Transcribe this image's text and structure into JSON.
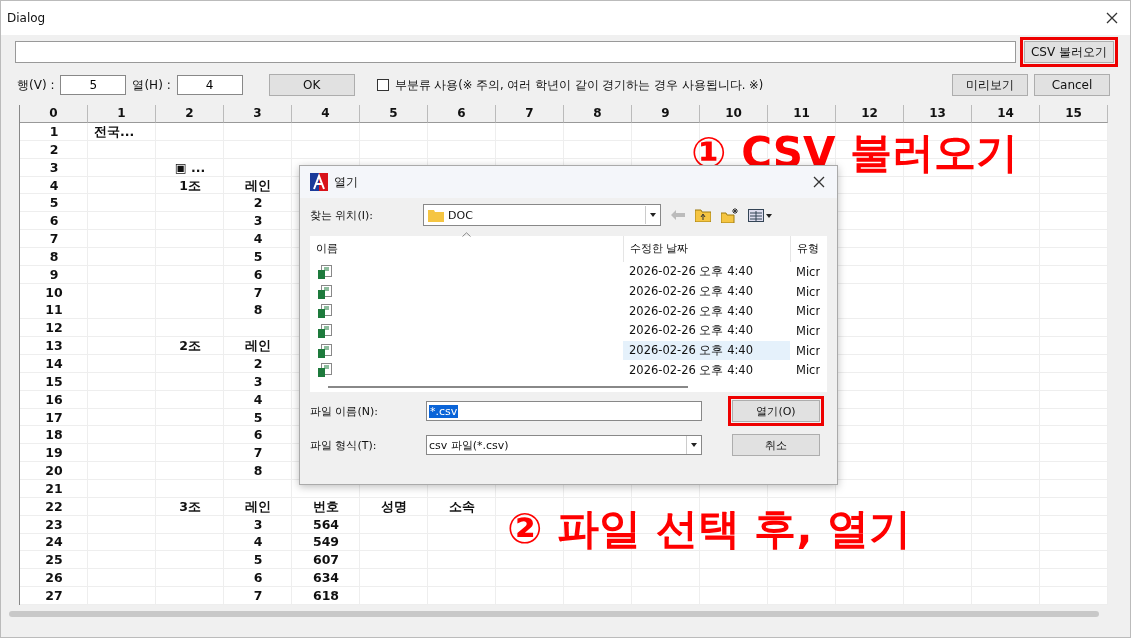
{
  "window": {
    "title": "Dialog"
  },
  "load_button": {
    "label": "CSV 불러오기"
  },
  "toolbar": {
    "rows_label": "행(V) :",
    "rows_value": "5",
    "cols_label": "열(H) :",
    "cols_value": "4",
    "ok": "OK",
    "subcategory": {
      "label": "부분류 사용(※ 주의, 여러 학년이 같이 경기하는 경우 사용됩니다. ※)",
      "checked": false
    },
    "preview": "미리보기",
    "cancel": "Cancel"
  },
  "grid": {
    "columns": [
      "0",
      "1",
      "2",
      "3",
      "4",
      "5",
      "6",
      "7",
      "8",
      "9",
      "10",
      "11",
      "12",
      "13",
      "14",
      "15"
    ],
    "rows": [
      {
        "label": "1",
        "cells": {
          "1": "전국..."
        }
      },
      {
        "label": "2",
        "cells": {}
      },
      {
        "label": "3",
        "cells": {
          "2": "▣ ..."
        }
      },
      {
        "label": "4",
        "cells": {
          "2": "1조",
          "3": "레인"
        }
      },
      {
        "label": "5",
        "cells": {
          "3": "2"
        }
      },
      {
        "label": "6",
        "cells": {
          "3": "3"
        }
      },
      {
        "label": "7",
        "cells": {
          "3": "4"
        }
      },
      {
        "label": "8",
        "cells": {
          "3": "5"
        }
      },
      {
        "label": "9",
        "cells": {
          "3": "6"
        }
      },
      {
        "label": "10",
        "cells": {
          "3": "7"
        }
      },
      {
        "label": "11",
        "cells": {
          "3": "8"
        }
      },
      {
        "label": "12",
        "cells": {}
      },
      {
        "label": "13",
        "cells": {
          "2": "2조",
          "3": "레인"
        }
      },
      {
        "label": "14",
        "cells": {
          "3": "2"
        }
      },
      {
        "label": "15",
        "cells": {
          "3": "3"
        }
      },
      {
        "label": "16",
        "cells": {
          "3": "4"
        }
      },
      {
        "label": "17",
        "cells": {
          "3": "5"
        }
      },
      {
        "label": "18",
        "cells": {
          "3": "6"
        }
      },
      {
        "label": "19",
        "cells": {
          "3": "7"
        }
      },
      {
        "label": "20",
        "cells": {
          "3": "8"
        }
      },
      {
        "label": "21",
        "cells": {}
      },
      {
        "label": "22",
        "cells": {
          "2": "3조",
          "3": "레인",
          "4": "번호",
          "5": "성명",
          "6": "소속"
        }
      },
      {
        "label": "23",
        "cells": {
          "3": "3",
          "4": "564"
        }
      },
      {
        "label": "24",
        "cells": {
          "3": "4",
          "4": "549"
        }
      },
      {
        "label": "25",
        "cells": {
          "3": "5",
          "4": "607"
        }
      },
      {
        "label": "26",
        "cells": {
          "3": "6",
          "4": "634"
        }
      },
      {
        "label": "27",
        "cells": {
          "3": "7",
          "4": "618"
        }
      }
    ]
  },
  "open_dialog": {
    "title": "열기",
    "look_in_label": "찾는 위치(I):",
    "look_in_value": "DOC",
    "list_columns": [
      "이름",
      "수정한 날짜",
      "유형"
    ],
    "files": [
      {
        "modified": "2026-02-26 오후 4:40",
        "type": "Micr",
        "selected": false
      },
      {
        "modified": "2026-02-26 오후 4:40",
        "type": "Micr",
        "selected": false
      },
      {
        "modified": "2026-02-26 오후 4:40",
        "type": "Micr",
        "selected": false
      },
      {
        "modified": "2026-02-26 오후 4:40",
        "type": "Micr",
        "selected": false
      },
      {
        "modified": "2026-02-26 오후 4:40",
        "type": "Micr",
        "selected": true
      },
      {
        "modified": "2026-02-26 오후 4:40",
        "type": "Micr",
        "selected": false
      }
    ],
    "file_name_label": "파일 이름(N):",
    "file_name_value": "*.csv",
    "file_type_label": "파일 형식(T):",
    "file_type_value": "csv 파일(*.csv)",
    "open_button": {
      "label": "열기(O)"
    },
    "cancel_button": "취소"
  },
  "annotations": [
    "① CSV 불러오기",
    "② 파일 선택 후, 열기"
  ]
}
